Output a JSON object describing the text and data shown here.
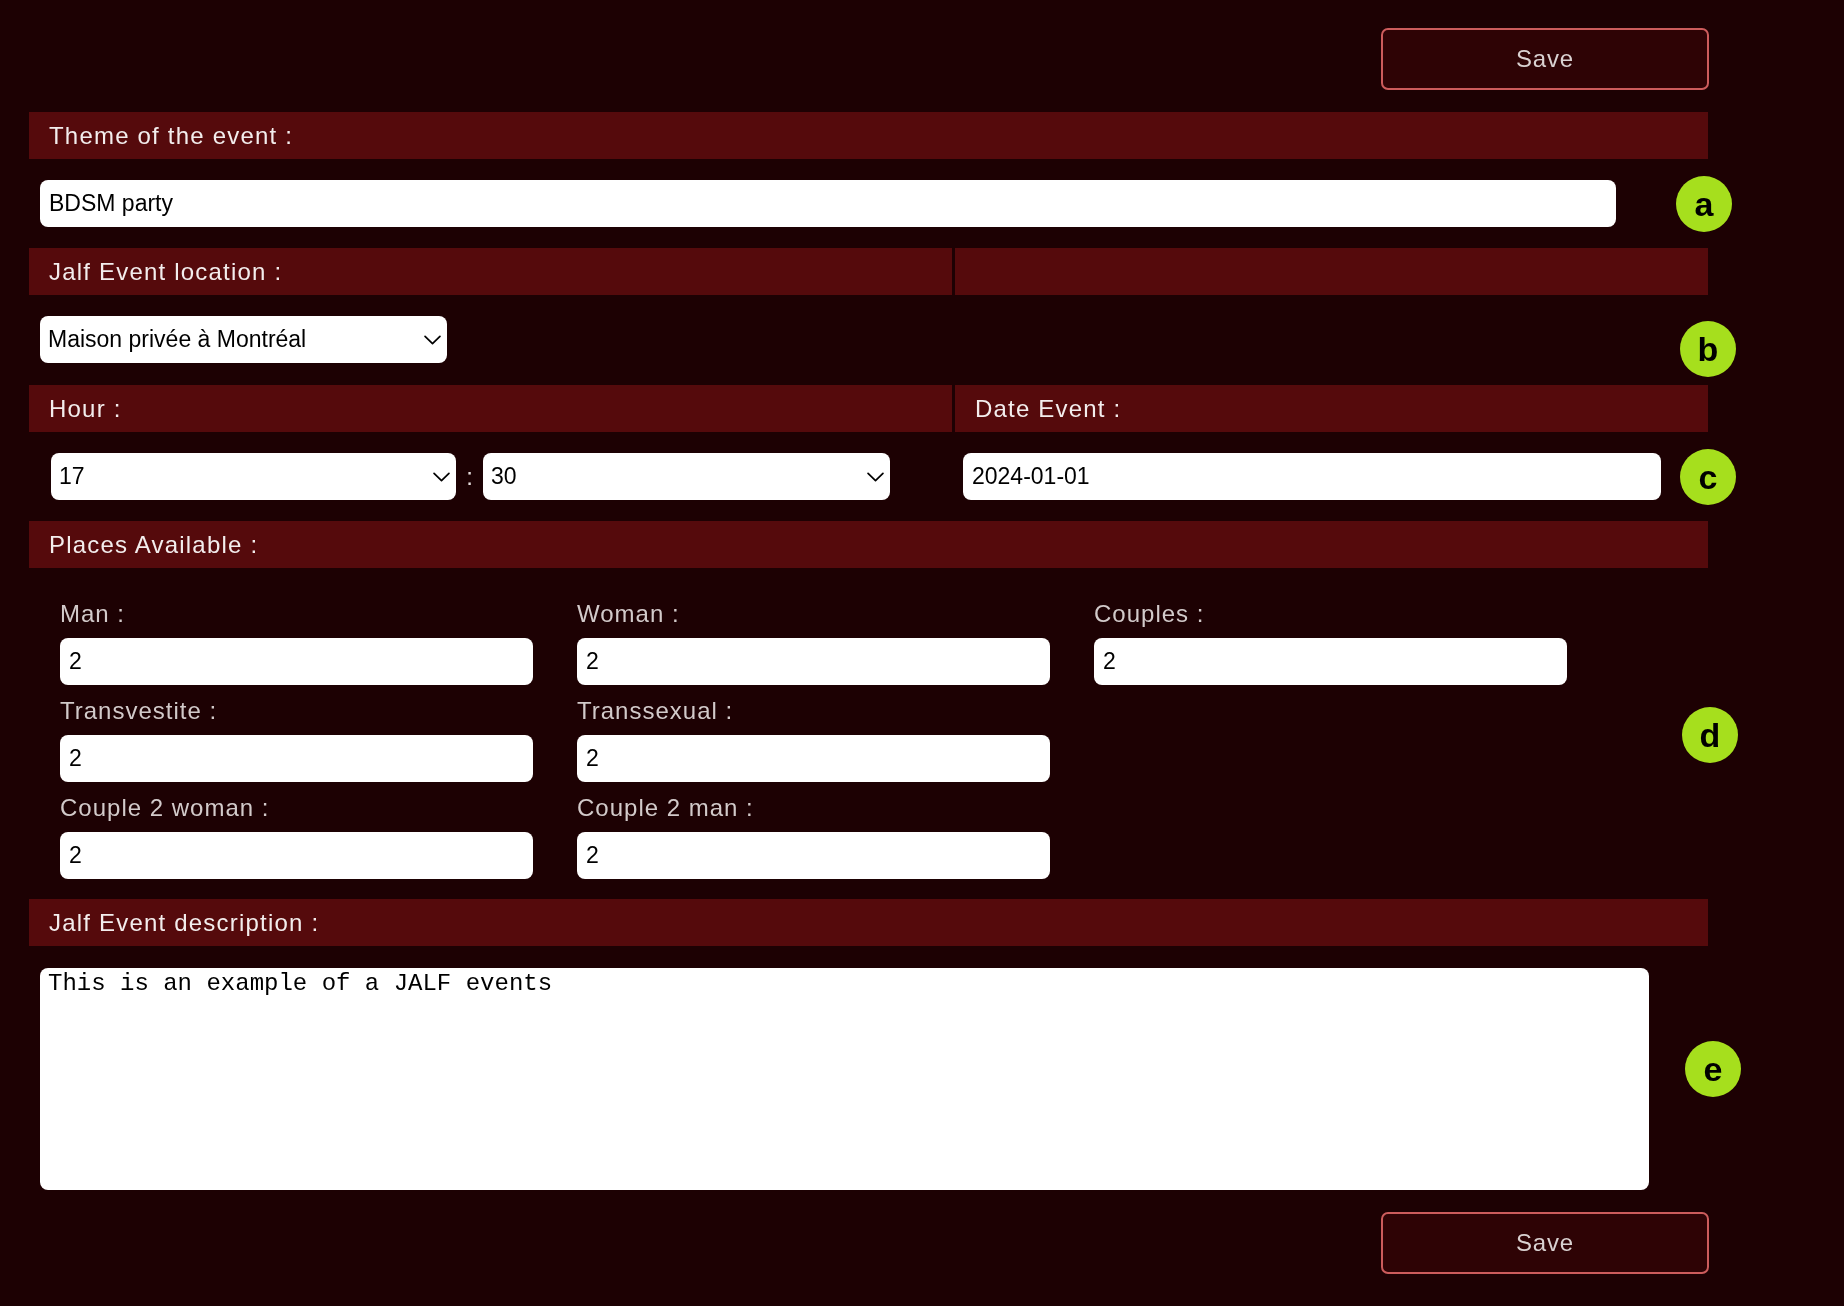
{
  "top_button": {
    "label": "Save"
  },
  "theme": {
    "header": "Theme of the event :",
    "value": "BDSM party",
    "marker": "a"
  },
  "location": {
    "header": "Jalf Event location :",
    "value": "Maison privée à Montréal",
    "marker": "b"
  },
  "time": {
    "hour_header": "Hour :",
    "hour": "17",
    "separator": ":",
    "minute": "30",
    "date_header": "Date Event :",
    "date": "2024-01-01",
    "marker": "c"
  },
  "places": {
    "header": "Places Available :",
    "rows": [
      [
        {
          "label": "Man :",
          "value": "2"
        },
        {
          "label": "Woman :",
          "value": "2"
        },
        {
          "label": "Couples :",
          "value": "2"
        }
      ],
      [
        {
          "label": "Transvestite :",
          "value": "2"
        },
        {
          "label": "Transsexual :",
          "value": "2"
        }
      ],
      [
        {
          "label": "Couple 2 woman :",
          "value": "2"
        },
        {
          "label": "Couple 2 man :",
          "value": "2"
        }
      ]
    ],
    "marker": "d"
  },
  "description": {
    "header": "Jalf Event description :",
    "value": "This is an example of a JALF events",
    "marker": "e"
  },
  "bottom_button": {
    "label": "Save"
  }
}
